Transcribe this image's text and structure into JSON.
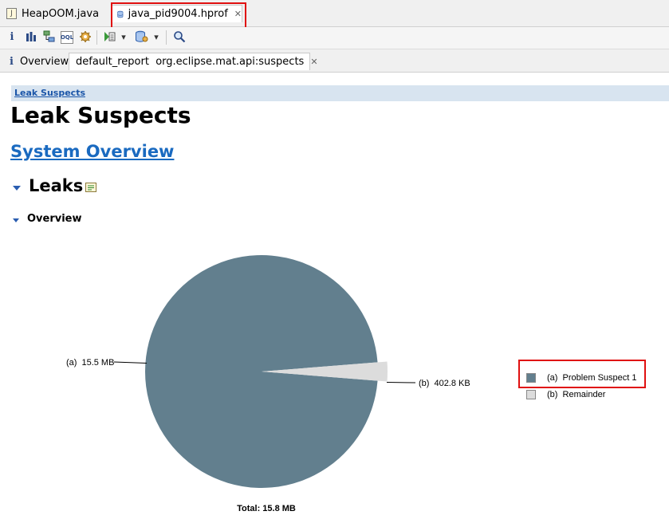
{
  "editor_tabs": [
    {
      "label": "HeapOOM.java",
      "icon": "java-file-icon"
    },
    {
      "label": "java_pid9004.hprof",
      "icon": "heap-dump-icon",
      "close": "✕"
    }
  ],
  "toolbar": {
    "info": "i",
    "histogram": "histogram-icon",
    "dominator": "dominator-tree-icon",
    "oql": "OQL",
    "query": "query-browser-icon",
    "report": "run-report-icon",
    "heapdump": "heap-dump-actions-icon",
    "search": "search-icon",
    "dropdown": "▾"
  },
  "sub_tabs": [
    {
      "label": "Overview",
      "icon": "i"
    },
    {
      "label": "default_report  org.eclipse.mat.api:suspects",
      "close": "✕"
    }
  ],
  "report": {
    "breadcrumb": "Leak Suspects",
    "title": "Leak Suspects",
    "system_overview": "System Overview",
    "leaks": "Leaks",
    "overview": "Overview"
  },
  "chart_data": {
    "type": "pie",
    "slices": [
      {
        "label": "(a)",
        "value_label": "15.5 MB",
        "value_mb": 15.4,
        "legend": "(a)  Problem Suspect 1",
        "color": "#627f8e"
      },
      {
        "label": "(b)",
        "value_label": "402.8 KB",
        "value_mb": 0.4,
        "legend": "(b)  Remainder",
        "color": "#dcdcdc"
      }
    ],
    "total": "Total: 15.8 MB",
    "legend_placement": "right"
  }
}
